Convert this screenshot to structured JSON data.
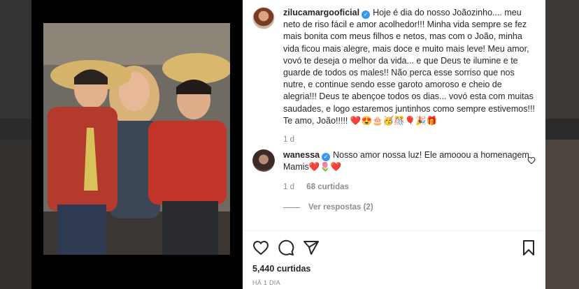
{
  "post": {
    "author": "zilucamargooficial",
    "caption": "Hoje é dia do nosso Joãozinho.... meu neto de riso fácil e amor acolhedor!!! Minha vida sempre se fez mais bonita com meus filhos e netos, mas com o João, minha vida ficou mais alegre, mais doce e muito mais leve! Meu amor, vovó te deseja o melhor da vida... e que Deus te ilumine e te guarde de todos os males!! Não perca esse sorriso que nos nutre, e continue sendo esse garoto amoroso e cheio de alegria!!! Deus te abençoe todos os dias... vovó esta com muitas saudades, e logo estaremos juntinhos como sempre estivemos!!! Te amo, João!!!!! ❤️😍🎂🥳🎊🎈🎉🎁",
    "age": "1 d",
    "likes": "5,440 curtidas",
    "time": "HÁ 1 DIA"
  },
  "comment": {
    "author": "wanessa",
    "text": "Nosso amor nossa luz! Ele amooou a homenagem Mamis❤️🌷❤️",
    "age": "1 d",
    "likes": "68 curtidas",
    "replies": "Ver respostas (2)"
  },
  "icons": {
    "verified": "verified-badge",
    "like": "heart-icon",
    "comment": "comment-icon",
    "share": "paper-plane-icon",
    "save": "bookmark-icon"
  },
  "colors": {
    "verified": "#3897f0",
    "muted": "#8e8e8e",
    "text": "#262626"
  }
}
